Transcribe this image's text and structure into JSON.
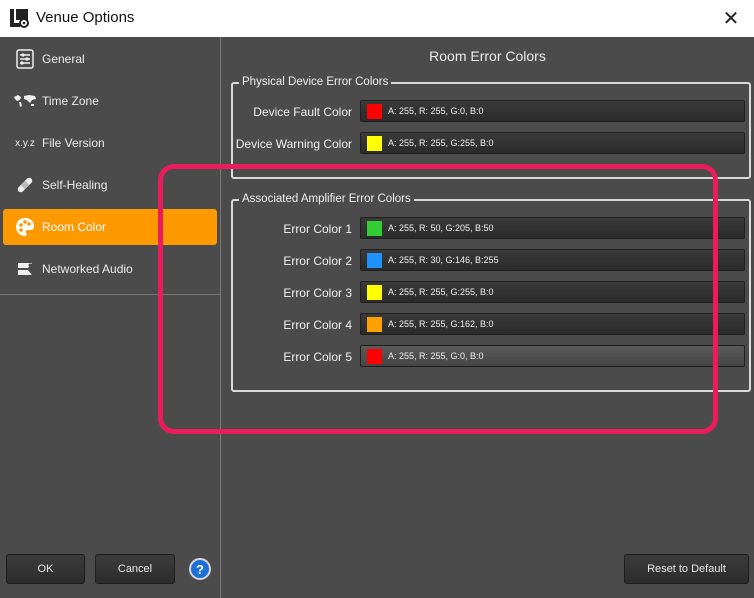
{
  "window": {
    "title": "Venue Options"
  },
  "sidebar": {
    "items": [
      {
        "label": "General",
        "icon": "settings-list-icon"
      },
      {
        "label": "Time Zone",
        "icon": "world-map-icon"
      },
      {
        "label": "File Version",
        "icon": "xyz-icon",
        "icon_text": "x.y.z"
      },
      {
        "label": "Self-Healing",
        "icon": "bandage-icon"
      },
      {
        "label": "Room Color",
        "icon": "palette-icon",
        "active": true
      },
      {
        "label": "Networked Audio",
        "icon": "network-audio-icon"
      }
    ]
  },
  "footer": {
    "ok_label": "OK",
    "cancel_label": "Cancel",
    "help_label": "?",
    "reset_label": "Reset to Default"
  },
  "main": {
    "title": "Room Error Colors",
    "physical": {
      "legend": "Physical Device Error Colors",
      "rows": [
        {
          "label": "Device Fault Color",
          "value": "A: 255, R: 255, G:0, B:0",
          "swatch": "#ff0000"
        },
        {
          "label": "Device Warning Color",
          "value": "A: 255, R: 255, G:255, B:0",
          "swatch": "#ffff00"
        }
      ]
    },
    "amplifier": {
      "legend": "Associated Amplifier Error Colors",
      "rows": [
        {
          "label": "Error Color 1",
          "value": "A: 255, R: 50, G:205, B:50",
          "swatch": "#32cd32"
        },
        {
          "label": "Error Color 2",
          "value": "A: 255, R: 30, G:146, B:255",
          "swatch": "#1e92ff"
        },
        {
          "label": "Error Color 3",
          "value": "A: 255, R: 255, G:255, B:0",
          "swatch": "#ffff00"
        },
        {
          "label": "Error Color 4",
          "value": "A: 255, R: 255, G:162, B:0",
          "swatch": "#ffa200"
        },
        {
          "label": "Error Color 5",
          "value": "A: 255, R: 255, G:0, B:0",
          "swatch": "#ff0000"
        }
      ]
    }
  },
  "colors": {
    "accent": "#ff9900",
    "background": "#4b4b4b",
    "annotation": "#ea1c5d"
  }
}
